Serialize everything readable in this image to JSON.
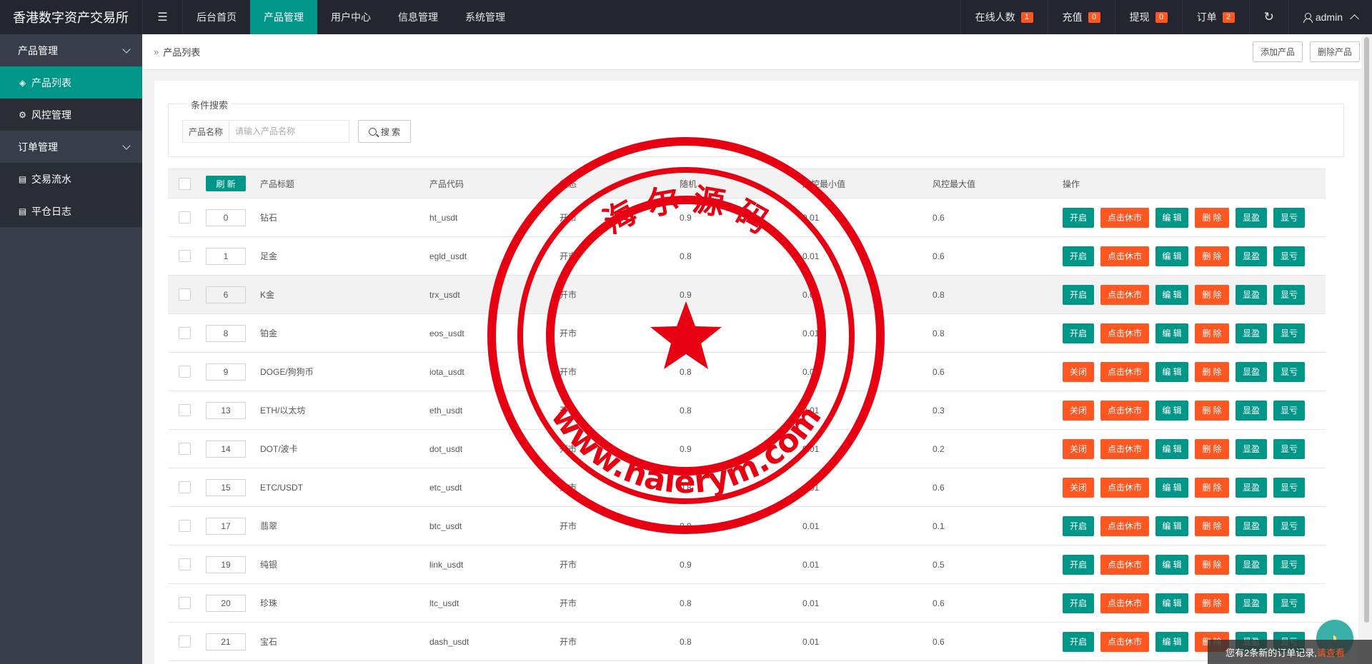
{
  "header": {
    "brand": "香港数字资产交易所",
    "nav": [
      "后台首页",
      "产品管理",
      "用户中心",
      "信息管理",
      "系统管理"
    ],
    "active_nav": 1,
    "online_label": "在线人数",
    "online_count": "1",
    "recharge_label": "充值",
    "recharge_count": "0",
    "withdraw_label": "提现",
    "withdraw_count": "0",
    "order_label": "订单",
    "order_count": "2",
    "user": "admin"
  },
  "sidebar": {
    "group1": "产品管理",
    "item_product_list": "产品列表",
    "item_risk": "风控管理",
    "group2": "订单管理",
    "item_flow": "交易流水",
    "item_log": "平仓日志"
  },
  "breadcrumb": "产品列表",
  "buttons": {
    "add": "添加产品",
    "delete": "删除产品"
  },
  "search": {
    "legend": "条件搜索",
    "label": "产品名称",
    "placeholder": "请输入产品名称",
    "button": "搜 索"
  },
  "table": {
    "refresh": "刷 新",
    "headers": [
      "产品标题",
      "产品代码",
      "状态",
      "随机",
      "风控最小值",
      "风控最大值",
      "操作"
    ],
    "rows": [
      {
        "sort": "0",
        "title": "钻石",
        "code": "ht_usdt",
        "status": "开市",
        "rand": "0.9",
        "min": "0.01",
        "max": "0.6",
        "toggle": "开启"
      },
      {
        "sort": "1",
        "title": "足金",
        "code": "egld_usdt",
        "status": "开市",
        "rand": "0.8",
        "min": "0.01",
        "max": "0.6",
        "toggle": "开启"
      },
      {
        "sort": "6",
        "title": "K金",
        "code": "trx_usdt",
        "status": "开市",
        "rand": "0.9",
        "min": "0.01",
        "max": "0.8",
        "toggle": "开启"
      },
      {
        "sort": "8",
        "title": "铂金",
        "code": "eos_usdt",
        "status": "开市",
        "rand": "0.8",
        "min": "0.01",
        "max": "0.8",
        "toggle": "开启"
      },
      {
        "sort": "9",
        "title": "DOGE/狗狗币",
        "code": "iota_usdt",
        "status": "开市",
        "rand": "0.8",
        "min": "0.01",
        "max": "0.6",
        "toggle": "关闭"
      },
      {
        "sort": "13",
        "title": "ETH/以太坊",
        "code": "eth_usdt",
        "status": "开市",
        "rand": "0.8",
        "min": "0.01",
        "max": "0.3",
        "toggle": "关闭"
      },
      {
        "sort": "14",
        "title": "DOT/波卡",
        "code": "dot_usdt",
        "status": "开市",
        "rand": "0.9",
        "min": "0.01",
        "max": "0.2",
        "toggle": "关闭"
      },
      {
        "sort": "15",
        "title": "ETC/USDT",
        "code": "etc_usdt",
        "status": "开市",
        "rand": "0.8",
        "min": "0.01",
        "max": "0.6",
        "toggle": "关闭"
      },
      {
        "sort": "17",
        "title": "翡翠",
        "code": "btc_usdt",
        "status": "开市",
        "rand": "0.8",
        "min": "0.01",
        "max": "0.1",
        "toggle": "开启"
      },
      {
        "sort": "19",
        "title": "纯银",
        "code": "link_usdt",
        "status": "开市",
        "rand": "0.9",
        "min": "0.01",
        "max": "0.5",
        "toggle": "开启"
      },
      {
        "sort": "20",
        "title": "珍珠",
        "code": "ltc_usdt",
        "status": "开市",
        "rand": "0.8",
        "min": "0.01",
        "max": "0.6",
        "toggle": "开启"
      },
      {
        "sort": "21",
        "title": "宝石",
        "code": "dash_usdt",
        "status": "开市",
        "rand": "0.8",
        "min": "0.01",
        "max": "0.6",
        "toggle": "开启"
      }
    ],
    "ops": {
      "rest": "点击休市",
      "edit": "编 辑",
      "delete": "删 除",
      "profit": "显盈",
      "loss": "显亏"
    }
  },
  "watermark": {
    "top_text": "海 尔 源 码",
    "bottom_text": "www.haierym.com"
  },
  "toast": {
    "text": "您有2条新的订单记录,",
    "link": "请查看"
  },
  "colors": {
    "primary": "#009688",
    "danger": "#ff5722",
    "header": "#23262e",
    "sidebar": "#393d49",
    "stamp": "#e60012"
  }
}
